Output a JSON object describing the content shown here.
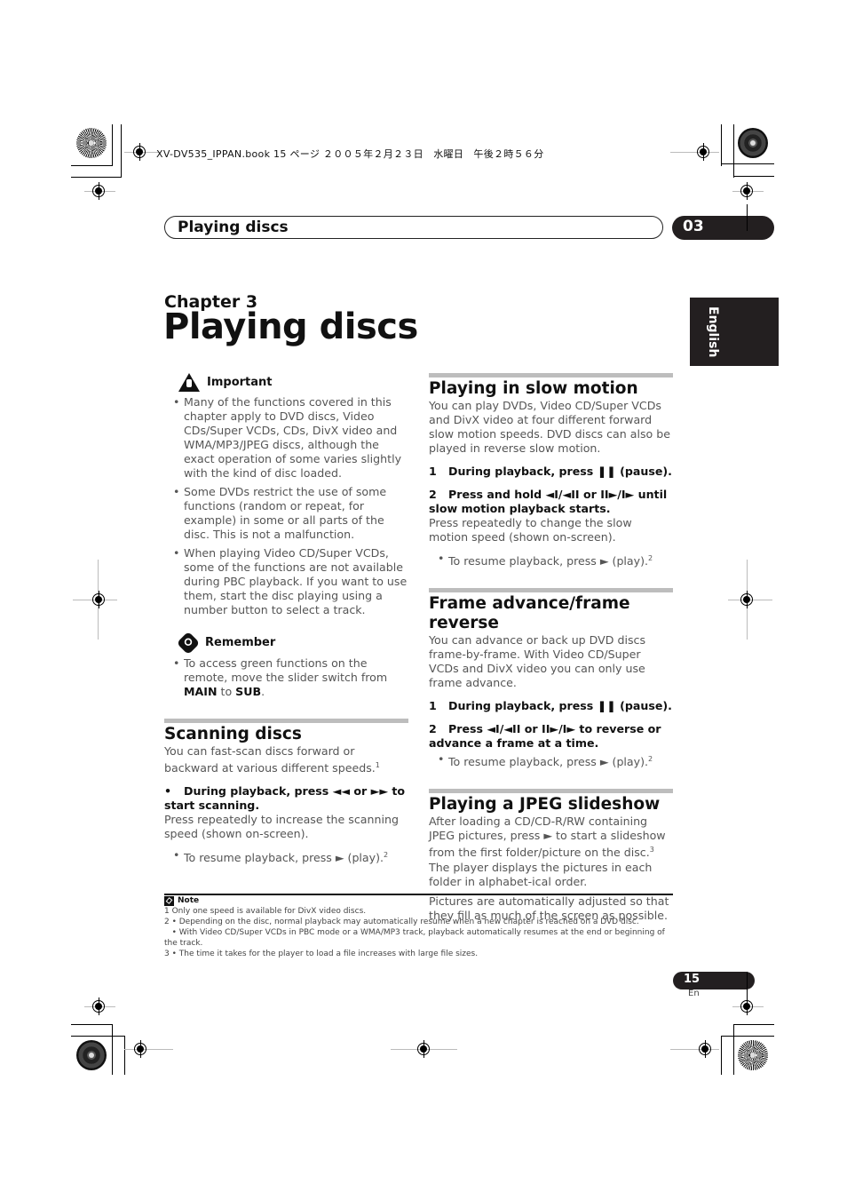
{
  "file_header": "XV-DV535_IPPAN.book  15 ページ  ２００５年２月２３日　水曜日　午後２時５６分",
  "header": {
    "section_title": "Playing discs",
    "chapter_number": "03"
  },
  "language_tab": "English",
  "chapter": {
    "label": "Chapter 3",
    "title": "Playing discs"
  },
  "important": {
    "heading": "Important",
    "icon": "warning-hand-icon",
    "items": [
      "Many of the functions covered in this chapter apply to DVD discs, Video CDs/Super VCDs, CDs, DivX video and WMA/MP3/JPEG discs, although the exact operation of some varies slightly with the kind of disc loaded.",
      "Some DVDs restrict the use of some functions (random or repeat, for example) in some or all parts of the disc. This is not a malfunction.",
      "When playing Video CD/Super VCDs, some of the functions are not available during PBC playback. If you want to use them, start the disc playing using a number button to select a track."
    ]
  },
  "remember": {
    "heading": "Remember",
    "icon": "remember-bubble-icon",
    "text_before": "To access green functions on the remote, move the slider switch from ",
    "main": "MAIN",
    "to": " to ",
    "sub": "SUB",
    "end": "."
  },
  "scanning": {
    "title": "Scanning discs",
    "intro": "You can fast-scan discs forward or backward at various different speeds.",
    "intro_note": "1",
    "step_bullet": "•",
    "step": "During playback, press ◄◄ or ►► to start scanning.",
    "step_desc": "Press repeatedly to increase the scanning speed (shown on-screen).",
    "resume": "To resume playback, press ► (play).",
    "resume_note": "2"
  },
  "slow_motion": {
    "title": "Playing in slow motion",
    "intro": "You can play DVDs, Video CD/Super VCDs and DivX video at four different forward slow motion speeds. DVD discs can also be played in reverse slow motion.",
    "steps": [
      {
        "n": "1",
        "text": "During playback, press ❚❚ (pause)."
      },
      {
        "n": "2",
        "text": "Press and hold ◄I/◄II or II►/I► until slow motion playback starts."
      }
    ],
    "step_desc": "Press repeatedly to change the slow motion speed (shown on-screen).",
    "resume": "To resume playback, press ► (play).",
    "resume_note": "2"
  },
  "frame": {
    "title": "Frame advance/frame reverse",
    "intro": "You can advance or back up DVD discs frame-by-frame. With Video CD/Super VCDs and DivX video you can only use frame advance.",
    "steps": [
      {
        "n": "1",
        "text": "During playback, press ❚❚ (pause)."
      },
      {
        "n": "2",
        "text": "Press ◄I/◄II or II►/I► to reverse or advance a frame at a time."
      }
    ],
    "resume": "To resume playback, press ► (play).",
    "resume_note": "2"
  },
  "jpeg": {
    "title": "Playing a JPEG slideshow",
    "intro_a": "After loading a CD/CD-R/RW containing JPEG pictures, press ► to start a slideshow from the first folder/picture on the disc.",
    "intro_note": "3",
    "intro_b": " The player displays the pictures in each folder in alphabet-ical order.",
    "para2": "Pictures are automatically adjusted so that they fill as much of the screen as possible."
  },
  "notes": {
    "heading": "Note",
    "lines": [
      "1 Only one speed is available for DivX video discs.",
      "2 • Depending on the disc, normal playback may automatically resume when a new chapter is reached on a DVD disc.",
      "   • With Video CD/Super VCDs in PBC mode or a WMA/MP3 track, playback automatically resumes at the end or beginning of the track.",
      "3 • The time it takes for the player to load a file increases with large file sizes."
    ]
  },
  "footer": {
    "page_number": "15",
    "page_lang": "En"
  }
}
